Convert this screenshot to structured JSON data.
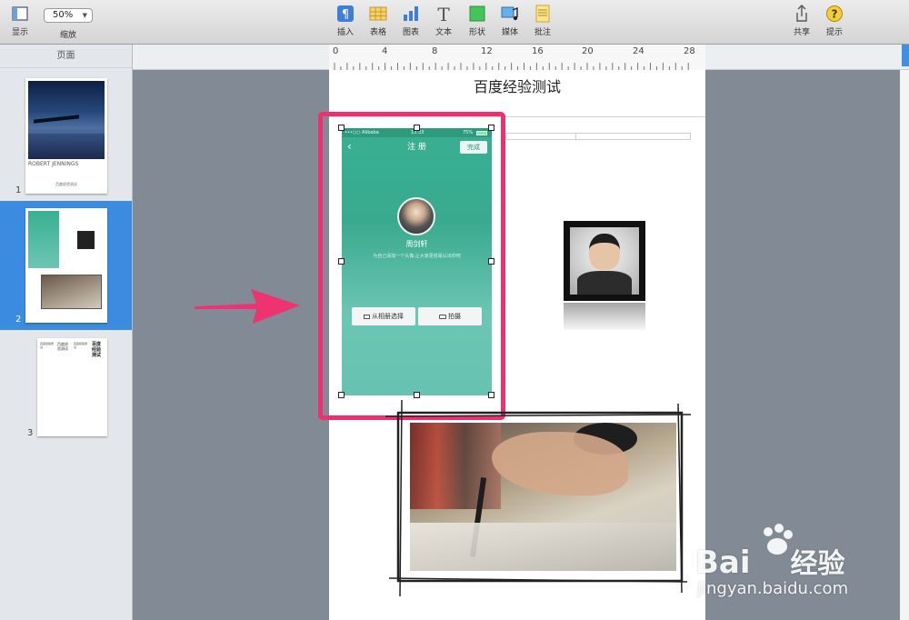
{
  "toolbar": {
    "view_label": "显示",
    "zoom_value": "50%",
    "zoom_label": "缩放",
    "insert_label": "插入",
    "table_label": "表格",
    "chart_label": "图表",
    "text_label": "文本",
    "shape_label": "形状",
    "media_label": "媒体",
    "comment_label": "批注",
    "share_label": "共享",
    "tips_label": "提示"
  },
  "sidebar": {
    "header": "页面",
    "pages": [
      {
        "number": "1",
        "caption": "ROBERT JENNINGS",
        "footer": "百度经验测试"
      },
      {
        "number": "2"
      },
      {
        "number": "3",
        "text_a": "百度经验测试",
        "text_b": "百度经验测试",
        "text_c": "百度经验测试",
        "text_d": "百度经验测试"
      }
    ]
  },
  "ruler": {
    "ticks": [
      "0",
      "4",
      "8",
      "12",
      "16",
      "20",
      "24",
      "28"
    ]
  },
  "page": {
    "title": "百度经验测试"
  },
  "phone": {
    "carrier": "•••○○ Alibaba",
    "time": "13:33",
    "battery": "75%",
    "nav_title": "注 册",
    "done_button": "完成",
    "username": "周剑轩",
    "hint": "为自己添加一个头像,让大家更容易认出你吧",
    "album_button": "从相册选择",
    "camera_button": "拍摄"
  },
  "watermark": {
    "brand": "Bai",
    "brand_suffix": "经验",
    "url": "jingyan.baidu.com"
  }
}
